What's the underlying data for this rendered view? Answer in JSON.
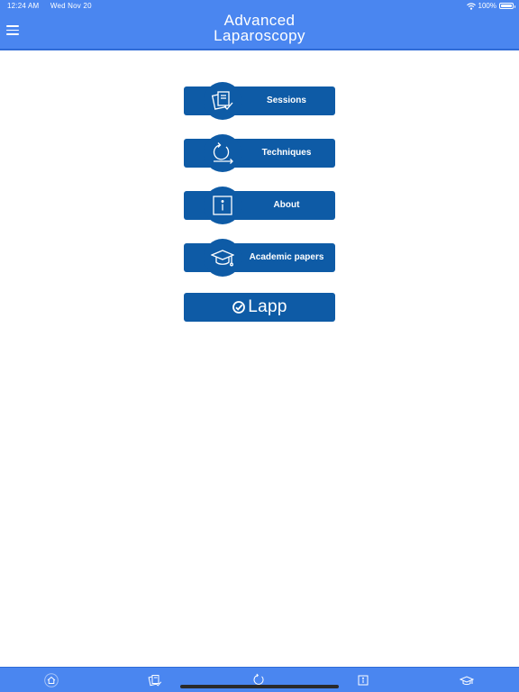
{
  "status_bar": {
    "time": "12:24 AM",
    "date": "Wed Nov 20",
    "battery": "100%"
  },
  "header": {
    "title_line1": "Advanced",
    "title_line2": "Laparoscopy"
  },
  "menu": {
    "items": [
      {
        "label": "Sessions",
        "icon": "sessions-icon"
      },
      {
        "label": "Techniques",
        "icon": "techniques-icon"
      },
      {
        "label": "About",
        "icon": "info-icon"
      },
      {
        "label": "Academic papers",
        "icon": "graduation-cap-icon"
      }
    ],
    "logo_text": "Lapp"
  },
  "tabbar": {
    "tabs": [
      "home-icon",
      "sessions-icon",
      "techniques-icon",
      "info-icon",
      "graduation-cap-icon"
    ]
  },
  "colors": {
    "header": "#4a86f0",
    "button": "#0e5ba6",
    "background": "#ffffff"
  }
}
